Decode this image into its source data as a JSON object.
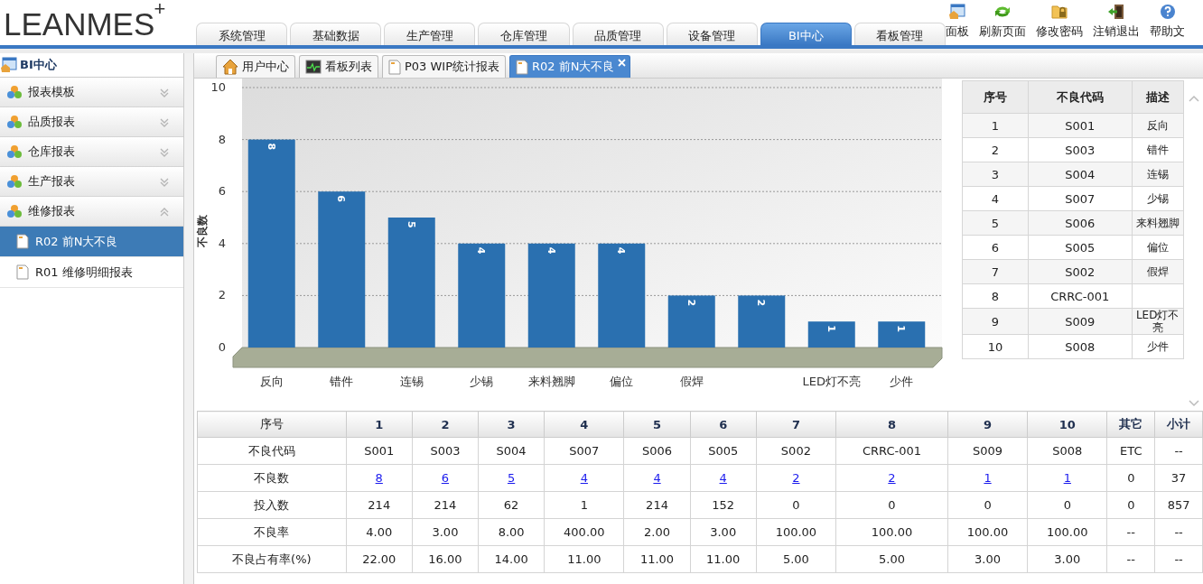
{
  "header": {
    "logo": "LEANMES",
    "logo_mark": "+",
    "nav_tabs": [
      {
        "label": "系统管理",
        "selected": false
      },
      {
        "label": "基础数据",
        "selected": false
      },
      {
        "label": "生产管理",
        "selected": false
      },
      {
        "label": "仓库管理",
        "selected": false
      },
      {
        "label": "品质管理",
        "selected": false
      },
      {
        "label": "设备管理",
        "selected": false
      },
      {
        "label": "BI中心",
        "selected": true
      },
      {
        "label": "看板管理",
        "selected": false
      }
    ],
    "toolbar": [
      {
        "kind": "dashboard",
        "label": "面板"
      },
      {
        "kind": "refresh",
        "label": "刷新页面"
      },
      {
        "kind": "password",
        "label": "修改密码"
      },
      {
        "kind": "logout",
        "label": "注销退出"
      },
      {
        "kind": "help",
        "label": "帮助文"
      }
    ]
  },
  "sidebar": {
    "title": "BI中心",
    "groups": [
      {
        "label": "报表模板",
        "expanded": false
      },
      {
        "label": "品质报表",
        "expanded": false
      },
      {
        "label": "仓库报表",
        "expanded": false
      },
      {
        "label": "生产报表",
        "expanded": false
      },
      {
        "label": "维修报表",
        "expanded": true,
        "items": [
          {
            "label": "R02 前N大不良",
            "selected": true
          },
          {
            "label": "R01 维修明细报表",
            "selected": false
          }
        ]
      }
    ]
  },
  "page_tabs": [
    {
      "kind": "home",
      "label": "用户中心",
      "selected": false
    },
    {
      "kind": "board",
      "label": "看板列表",
      "selected": false
    },
    {
      "kind": "doc",
      "label": "P03 WIP统计报表",
      "selected": false
    },
    {
      "kind": "doc",
      "label": "R02 前N大不良",
      "selected": true,
      "closable": true
    }
  ],
  "chart": {
    "chart_data": {
      "type": "bar",
      "ylabel": "不良数",
      "categories": [
        "反向",
        "错件",
        "连锡",
        "少锡",
        "来料翘脚",
        "偏位",
        "假焊",
        null,
        "LED灯不亮",
        "少件"
      ],
      "values": [
        8,
        6,
        5,
        4,
        4,
        4,
        2,
        2,
        1,
        1
      ],
      "ylim": [
        0,
        10
      ],
      "yticks": [
        0,
        2,
        4,
        6,
        8,
        10
      ],
      "grid": true,
      "data_labels": true
    }
  },
  "code_table": {
    "columns": [
      "序号",
      "不良代码",
      "描述"
    ],
    "rows": [
      {
        "no": "1",
        "code": "S001",
        "desc": "反向"
      },
      {
        "no": "2",
        "code": "S003",
        "desc": "错件"
      },
      {
        "no": "3",
        "code": "S004",
        "desc": "连锡"
      },
      {
        "no": "4",
        "code": "S007",
        "desc": "少锡"
      },
      {
        "no": "5",
        "code": "S006",
        "desc": "来料翘脚"
      },
      {
        "no": "6",
        "code": "S005",
        "desc": "偏位"
      },
      {
        "no": "7",
        "code": "S002",
        "desc": "假焊"
      },
      {
        "no": "8",
        "code": "CRRC-001"
      },
      {
        "no": "9",
        "code": "S009",
        "desc": "LED灯不亮"
      },
      {
        "no": "10",
        "code": "S008",
        "desc": "少件"
      }
    ]
  },
  "summary_table": {
    "columns": [
      "序号",
      "1",
      "2",
      "3",
      "4",
      "5",
      "6",
      "7",
      "8",
      "9",
      "10",
      "其它",
      "小计"
    ],
    "rows": [
      {
        "kind": "text",
        "cells": [
          "不良代码",
          "S001",
          "S003",
          "S004",
          "S007",
          "S006",
          "S005",
          "S002",
          "CRRC-001",
          "S009",
          "S008",
          "ETC",
          "--"
        ]
      },
      {
        "kind": "link",
        "cells": [
          "不良数",
          "8",
          "6",
          "5",
          "4",
          "4",
          "4",
          "2",
          "2",
          "1",
          "1",
          "0",
          "37"
        ]
      },
      {
        "kind": "text",
        "cells": [
          "投入数",
          "214",
          "214",
          "62",
          "1",
          "214",
          "152",
          "0",
          "0",
          "0",
          "0",
          "0",
          "857"
        ]
      },
      {
        "kind": "text",
        "cells": [
          "不良率",
          "4.00",
          "3.00",
          "8.00",
          "400.00",
          "2.00",
          "3.00",
          "100.00",
          "100.00",
          "100.00",
          "100.00",
          "--",
          "--"
        ]
      },
      {
        "kind": "text",
        "cells": [
          "不良占有率(%)",
          "22.00",
          "16.00",
          "14.00",
          "11.00",
          "11.00",
          "11.00",
          "5.00",
          "5.00",
          "3.00",
          "3.00",
          "--",
          "--"
        ]
      }
    ]
  }
}
